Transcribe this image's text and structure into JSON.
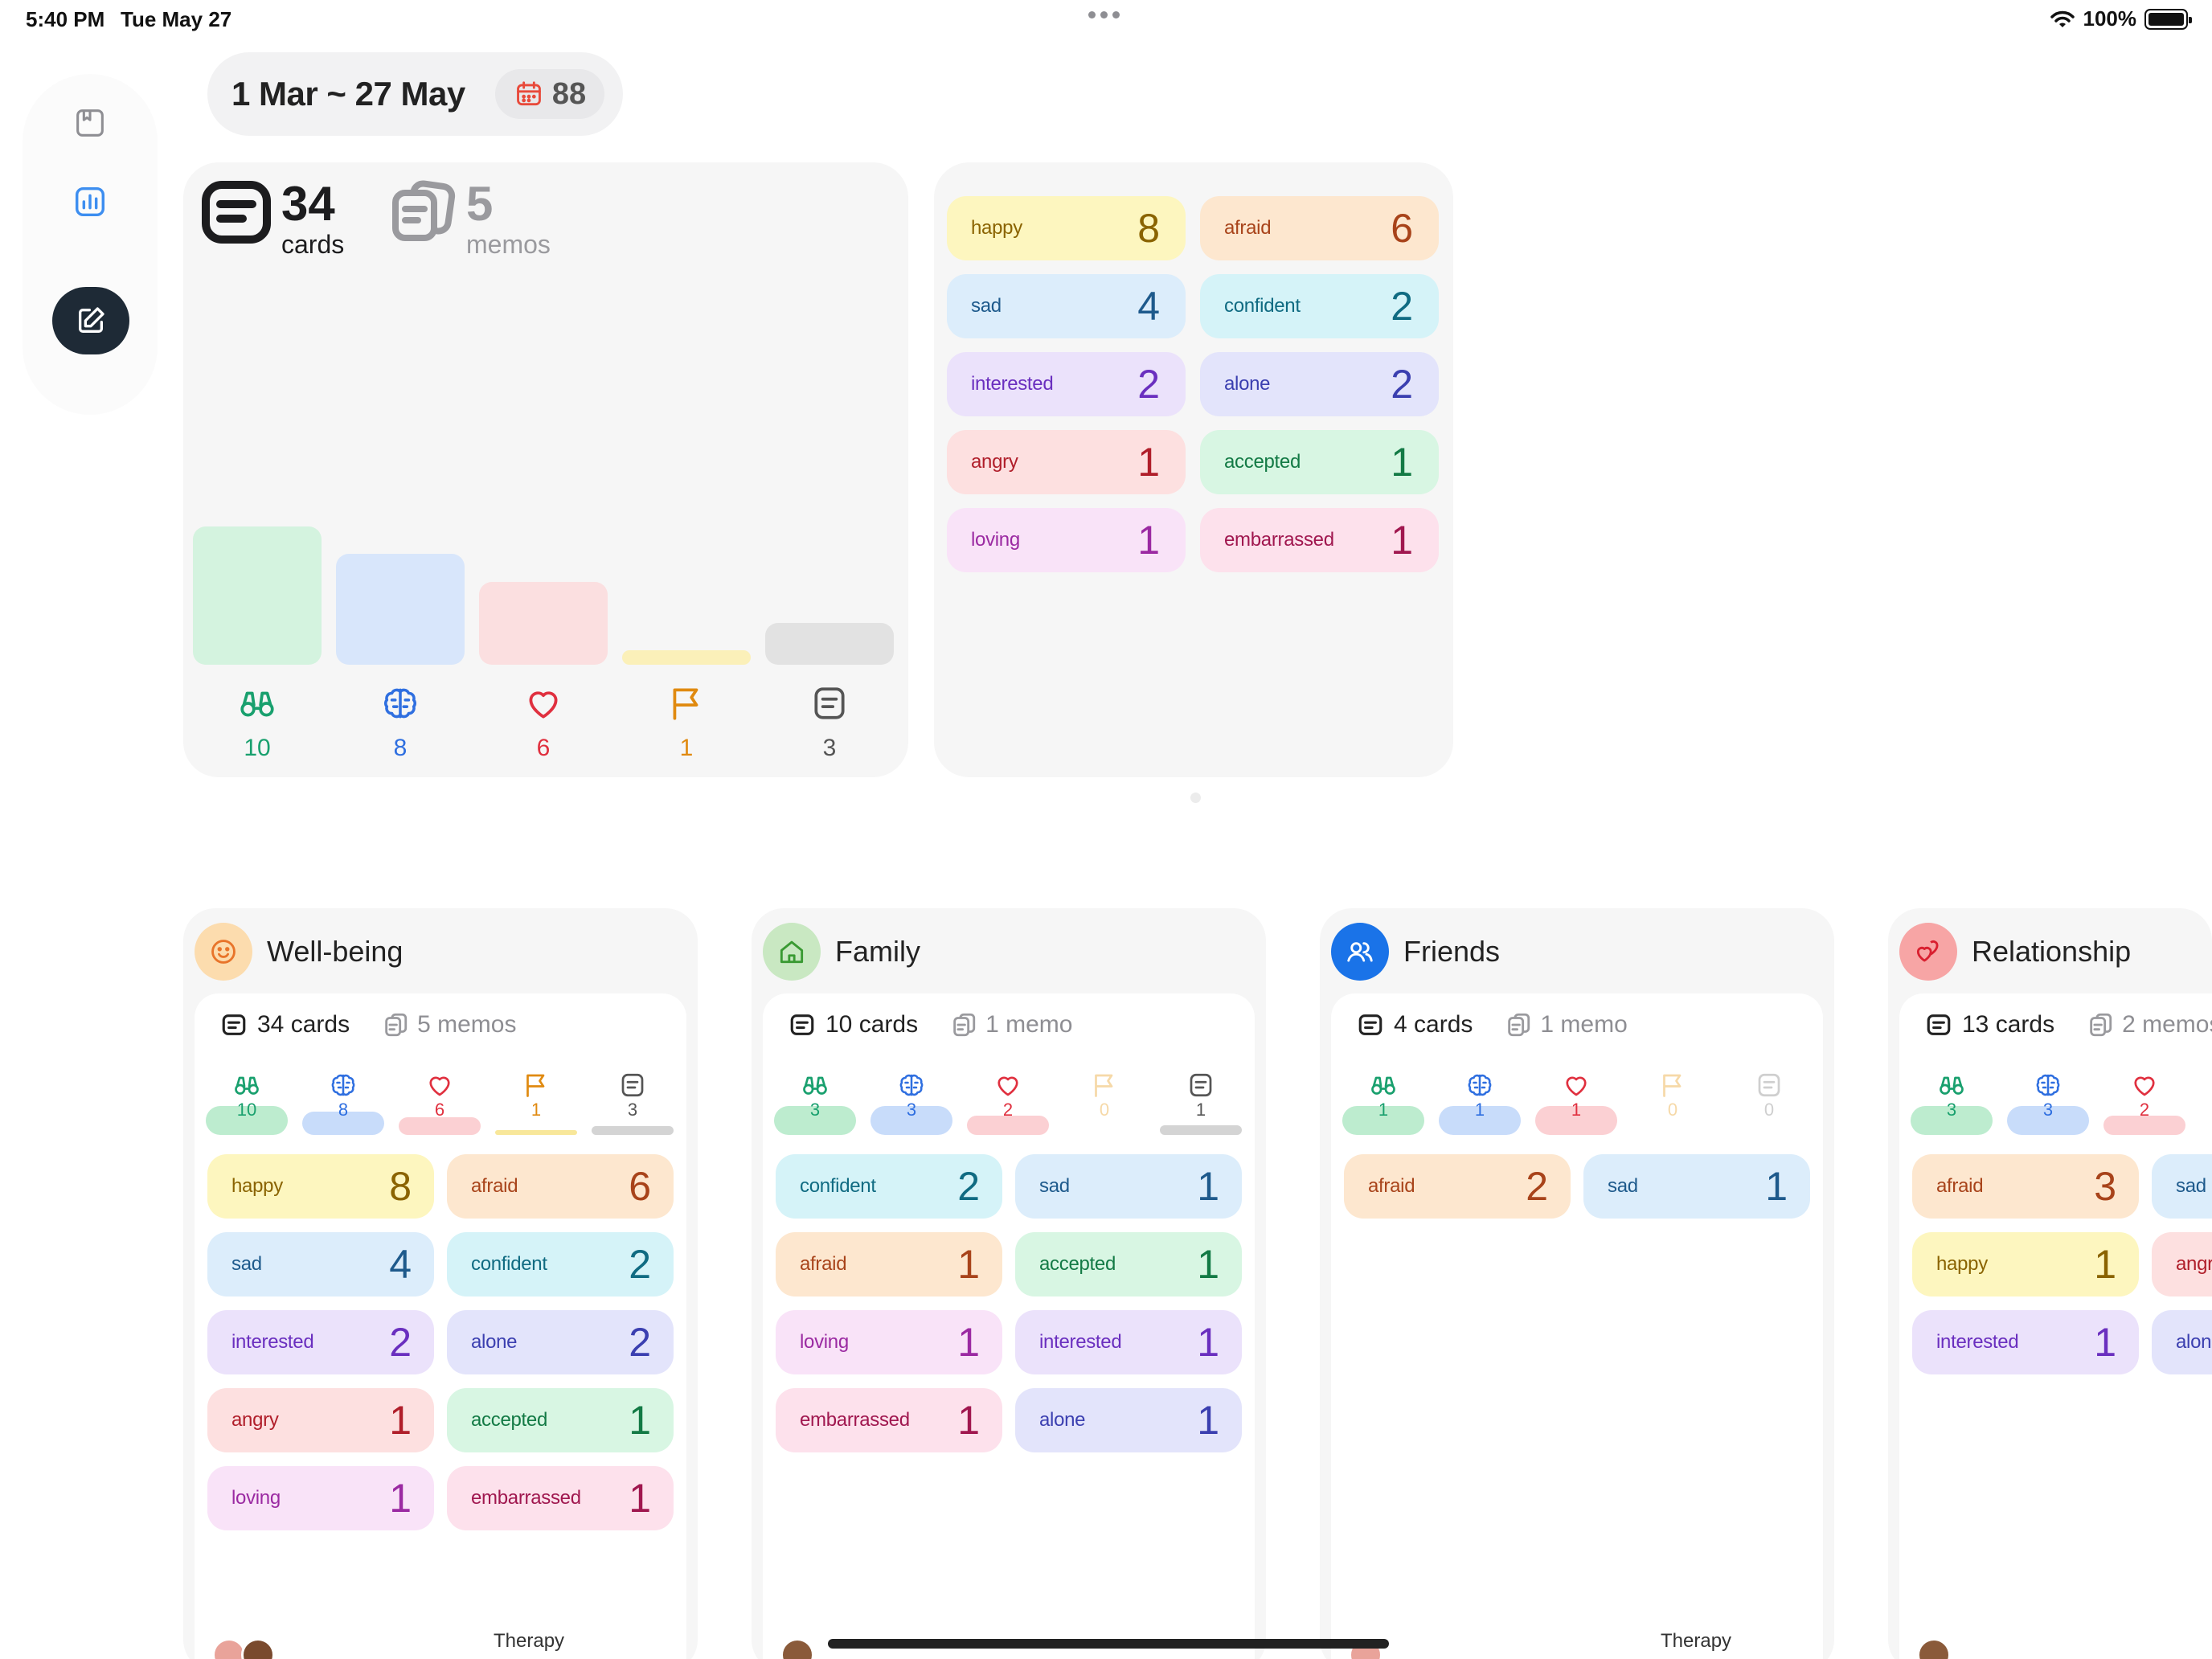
{
  "status_bar": {
    "time": "5:40 PM",
    "date": "Tue May 27",
    "battery": "100%"
  },
  "date_range": {
    "label": "1 Mar ~ 27 May",
    "count": "88"
  },
  "summary": {
    "cards_count": "34",
    "cards_label": "cards",
    "memos_count": "5",
    "memos_label": "memos",
    "colors": {
      "green": "#19a06e",
      "blue": "#2f6fe0",
      "red": "#e0303f",
      "orange": "#e08a10",
      "gray": "#555555"
    },
    "bars": [
      {
        "icon": "binoculars-icon",
        "value": "10",
        "fraction": 1.0
      },
      {
        "icon": "brain-icon",
        "value": "8",
        "fraction": 0.8
      },
      {
        "icon": "heart-icon",
        "value": "6",
        "fraction": 0.6
      },
      {
        "icon": "flag-icon",
        "value": "1",
        "fraction": 0.1
      },
      {
        "icon": "note-icon",
        "value": "3",
        "fraction": 0.3
      }
    ]
  },
  "emotions": [
    {
      "label": "happy",
      "value": "8",
      "bg": "#fdf6bf",
      "fg": "#8a6300"
    },
    {
      "label": "afraid",
      "value": "6",
      "bg": "#fde7cf",
      "fg": "#a8431a"
    },
    {
      "label": "sad",
      "value": "4",
      "bg": "#dcedfb",
      "fg": "#1e5a8c"
    },
    {
      "label": "confident",
      "value": "2",
      "bg": "#d5f3f8",
      "fg": "#106b82"
    },
    {
      "label": "interested",
      "value": "2",
      "bg": "#ebe2fb",
      "fg": "#6a2fbf"
    },
    {
      "label": "alone",
      "value": "2",
      "bg": "#e3e4fb",
      "fg": "#3b3fb0"
    },
    {
      "label": "angry",
      "value": "1",
      "bg": "#fde0e0",
      "fg": "#b01e2a"
    },
    {
      "label": "accepted",
      "value": "1",
      "bg": "#d8f6e3",
      "fg": "#137a45"
    },
    {
      "label": "loving",
      "value": "1",
      "bg": "#f9e3f8",
      "fg": "#9b2aa2"
    },
    {
      "label": "embarrassed",
      "value": "1",
      "bg": "#fde1ec",
      "fg": "#a0174f"
    }
  ],
  "categories": [
    {
      "title": "Well-being",
      "cards": "34 cards",
      "memos": "5 memos",
      "mini": [
        "10",
        "8",
        "6",
        "1",
        "3"
      ],
      "chips": [
        {
          "label": "happy",
          "value": "8"
        },
        {
          "label": "afraid",
          "value": "6"
        },
        {
          "label": "sad",
          "value": "4"
        },
        {
          "label": "confident",
          "value": "2"
        },
        {
          "label": "interested",
          "value": "2"
        },
        {
          "label": "alone",
          "value": "2"
        },
        {
          "label": "angry",
          "value": "1"
        },
        {
          "label": "accepted",
          "value": "1"
        },
        {
          "label": "loving",
          "value": "1"
        },
        {
          "label": "embarrassed",
          "value": "1"
        }
      ],
      "footer": "Therapy"
    },
    {
      "title": "Family",
      "cards": "10 cards",
      "memos": "1 memo",
      "mini": [
        "3",
        "3",
        "2",
        "0",
        "1"
      ],
      "chips": [
        {
          "label": "confident",
          "value": "2"
        },
        {
          "label": "sad",
          "value": "1"
        },
        {
          "label": "afraid",
          "value": "1"
        },
        {
          "label": "accepted",
          "value": "1"
        },
        {
          "label": "loving",
          "value": "1"
        },
        {
          "label": "interested",
          "value": "1"
        },
        {
          "label": "embarrassed",
          "value": "1"
        },
        {
          "label": "alone",
          "value": "1"
        }
      ],
      "footer": ""
    },
    {
      "title": "Friends",
      "cards": "4 cards",
      "memos": "1 memo",
      "mini": [
        "1",
        "1",
        "1",
        "0",
        "0"
      ],
      "chips": [
        {
          "label": "afraid",
          "value": "2"
        },
        {
          "label": "sad",
          "value": "1"
        }
      ],
      "footer": "Therapy"
    },
    {
      "title": "Relationship",
      "cards": "13 cards",
      "memos": "2 memos",
      "mini": [
        "3",
        "3",
        "2",
        "",
        ""
      ],
      "chips": [
        {
          "label": "afraid",
          "value": "3"
        },
        {
          "label": "sad",
          "value": ""
        },
        {
          "label": "happy",
          "value": "1"
        },
        {
          "label": "angry",
          "value": ""
        },
        {
          "label": "interested",
          "value": "1"
        },
        {
          "label": "alone",
          "value": ""
        }
      ],
      "footer": ""
    }
  ]
}
